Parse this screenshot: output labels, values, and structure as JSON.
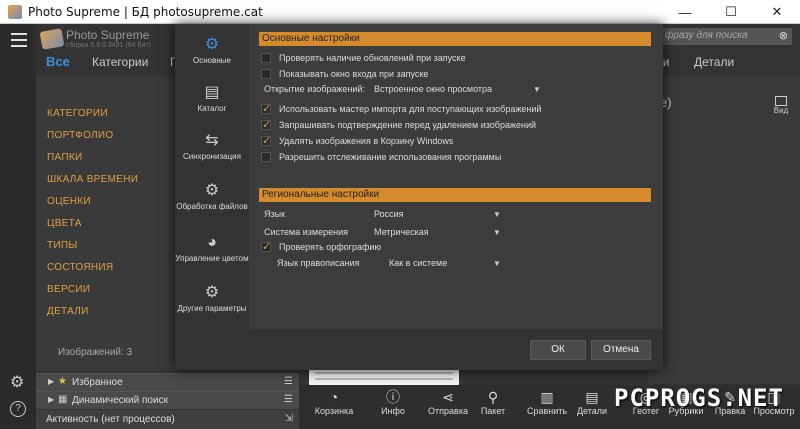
{
  "window": {
    "title": "Photo Supreme | БД photosupreme.cat",
    "minimize": "—",
    "maximize": "☐",
    "close": "✕"
  },
  "header": {
    "app_name": "Photo Supreme",
    "app_build": "сборка 5.6.0.3431 (64 бит)",
    "nav_all": "Все",
    "nav_categories": "Категории",
    "nav_partial": "Г",
    "nav_partial2": "ии",
    "nav_details": "Детали",
    "search_placeholder": "фразу для поиска"
  },
  "left_panel": {
    "items": [
      "КАТЕГОРИИ",
      "ПОРТФОЛИО",
      "ПАПКИ",
      "ШКАЛА ВРЕМЕНИ",
      "ОЦЕНКИ",
      "ЦВЕТА",
      "ТИПЫ",
      "СОСТОЯНИЯ",
      "ВЕРСИИ",
      "ДЕТАЛИ"
    ],
    "count": "Изображений: 3"
  },
  "right_area": {
    "paren": "е)",
    "view_label": "Вид"
  },
  "sections": {
    "favorites": "Избранное",
    "dynamic_search": "Динамический поиск",
    "activity": "Активность (нет процессов)"
  },
  "toolbar": [
    "Корзинка",
    "Инфо",
    "Отправка",
    "Пакет",
    "Сравнить",
    "Детали",
    "Геотег",
    "Рубрики",
    "Правка",
    "Просмотр"
  ],
  "watermark": "PCPROGS.NET",
  "dialog": {
    "categories": [
      "Основные",
      "Каталог",
      "Синхронизация",
      "Обработка файлов",
      "Управление цветом",
      "Другие параметры"
    ],
    "general_title": "Основные настройки",
    "options": [
      {
        "label": "Проверять наличие обновлений при запуске",
        "checked": false
      },
      {
        "label": "Показывать окно входа при запуске",
        "checked": false
      }
    ],
    "open_images_label": "Открытие изображений:",
    "open_images_value": "Встроенное окно просмотра",
    "options2": [
      {
        "label": "Использовать мастер импорта для поступающих изображений",
        "checked": true
      },
      {
        "label": "Запрашивать подтверждение перед удалением изображений",
        "checked": true
      },
      {
        "label": "Удалять изображения в Корзину Windows",
        "checked": true
      },
      {
        "label": "Разрешить отслеживание использования программы",
        "checked": false
      }
    ],
    "regional_title": "Региональные настройки",
    "language_label": "Язык",
    "language_value": "Россия",
    "units_label": "Система измерения",
    "units_value": "Метрическая",
    "spellcheck_label": "Проверять орфографию",
    "spellcheck_checked": true,
    "spell_lang_label": "Язык правописания",
    "spell_lang_value": "Как в системе",
    "ok": "ОК",
    "cancel": "Отмена"
  }
}
